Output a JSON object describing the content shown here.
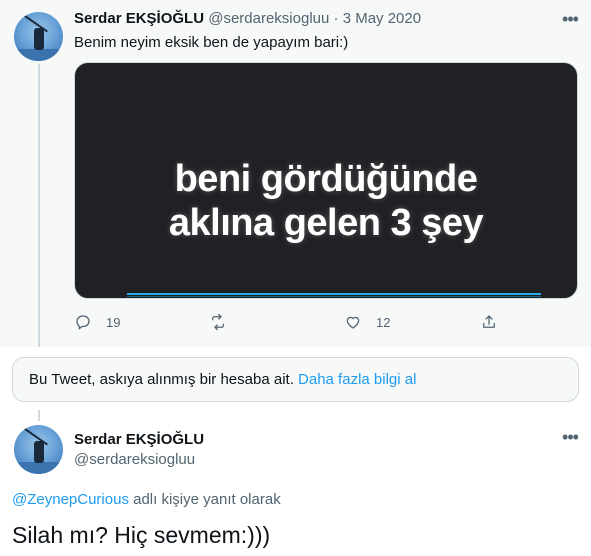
{
  "tweet1": {
    "author_name": "Serdar EKŞİOĞLU",
    "handle": "@serdareksiogluu",
    "separator": "·",
    "date": "3 May 2020",
    "text": "Benim neyim eksik ben de yapayım bari:)",
    "media": {
      "caption_line1": "beni gördüğünde",
      "caption_line2": "aklına gelen 3 şey"
    },
    "actions": {
      "reply_count": "19",
      "retweet_count": "",
      "like_count": "12"
    },
    "more_icon": "more-horizontal-icon"
  },
  "notice": {
    "text": "Bu Tweet, askıya alınmış bir hesaba ait.",
    "link": "Daha fazla bilgi al"
  },
  "tweet2": {
    "author_name": "Serdar EKŞİOĞLU",
    "handle": "@serdareksiogluu",
    "reply_mention": "@ZeynepCurious",
    "reply_suffix": " adlı kişiye yanıt olarak",
    "text": "Silah mı? Hiç sevmem:)))",
    "more_icon": "more-horizontal-icon"
  },
  "colors": {
    "accent": "#1d9bf0",
    "muted": "#536471",
    "border": "#cfd9de",
    "thread_bg": "#f7f9f9"
  }
}
